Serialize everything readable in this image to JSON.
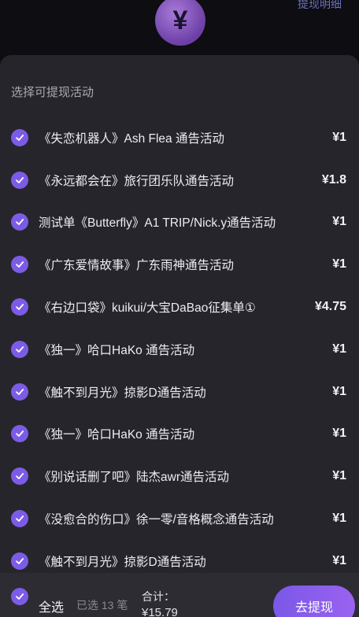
{
  "header": {
    "currency_symbol": "¥",
    "detail_link": "提现明细"
  },
  "sheet": {
    "title": "选择可提现活动",
    "items": [
      {
        "label": "《失恋机器人》Ash Flea 通告活动",
        "amount": "¥1",
        "checked": true
      },
      {
        "label": "《永远都会在》旅行团乐队通告活动",
        "amount": "¥1.8",
        "checked": true
      },
      {
        "label": "测试单《Butterfly》A1 TRIP/Nick.y通告活动",
        "amount": "¥1",
        "checked": true
      },
      {
        "label": "《广东爱情故事》广东雨神通告活动",
        "amount": "¥1",
        "checked": true
      },
      {
        "label": "《右边口袋》kuikui/大宝DaBao征集单①",
        "amount": "¥4.75",
        "checked": true
      },
      {
        "label": "《独一》哈口HaKo 通告活动",
        "amount": "¥1",
        "checked": true
      },
      {
        "label": "《触不到月光》掠影D通告活动",
        "amount": "¥1",
        "checked": true
      },
      {
        "label": "《独一》哈口HaKo 通告活动",
        "amount": "¥1",
        "checked": true
      },
      {
        "label": "《别说话删了吧》陆杰awr通告活动",
        "amount": "¥1",
        "checked": true
      },
      {
        "label": "《没愈合的伤口》徐一零/音格概念通告活动",
        "amount": "¥1",
        "checked": true
      },
      {
        "label": "《触不到月光》掠影D通告活动",
        "amount": "¥1",
        "checked": true
      }
    ]
  },
  "footer": {
    "select_all_label": "全选",
    "selected_count": "已选 13 笔",
    "total_label": "合计：",
    "total_value": "¥15.79",
    "withdraw_button": "去提现"
  },
  "colors": {
    "accent": "#7c5ce6",
    "sheet_bg": "#26252c",
    "page_bg": "#0b0b10"
  }
}
